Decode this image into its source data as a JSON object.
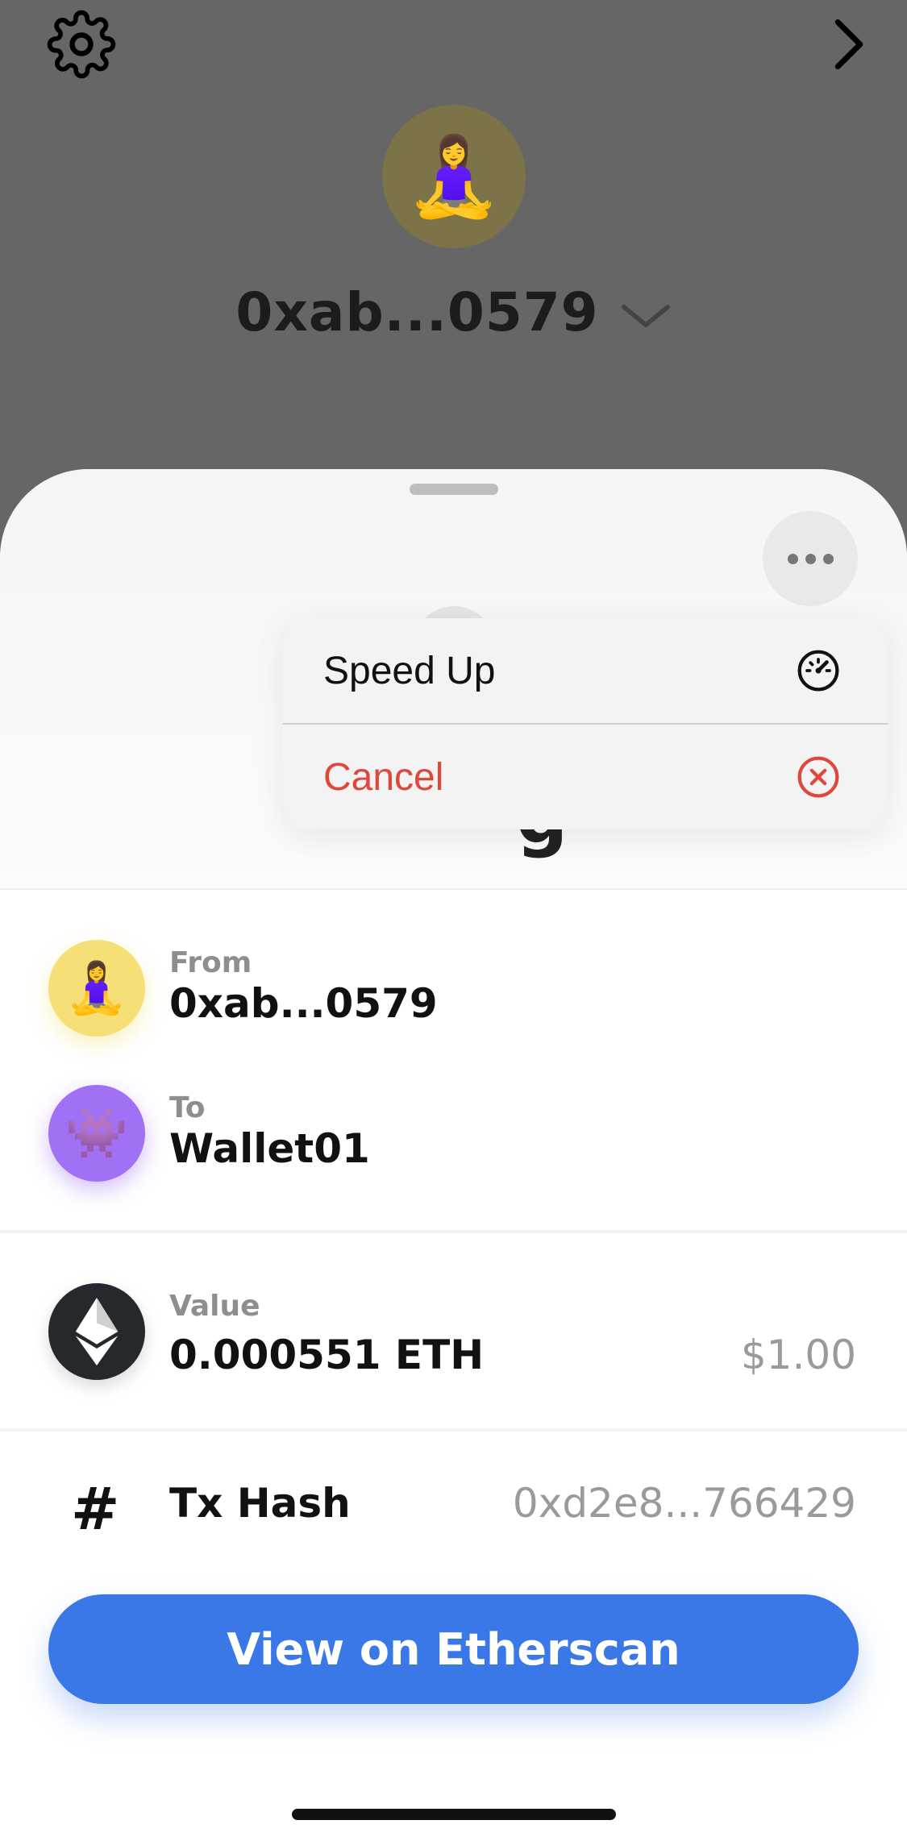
{
  "header": {
    "settings_icon": "gear-icon",
    "next_icon": "chevron-right-icon",
    "avatar_emoji": "🧘‍♀️",
    "wallet_address": "0xab...0579",
    "dropdown_icon": "chevron-down-icon"
  },
  "sheet": {
    "more_icon": "ellipsis-icon",
    "menu": {
      "speed_up_label": "Speed Up",
      "speed_up_icon": "speedometer-icon",
      "cancel_label": "Cancel",
      "cancel_icon": "x-circle-icon",
      "cancel_color": "#e0473b"
    },
    "from": {
      "label": "From",
      "address": "0xab...0579",
      "avatar_emoji": "🧘‍♀️",
      "avatar_color": "#f7df78"
    },
    "to": {
      "label": "To",
      "address": "Wallet01",
      "avatar_emoji": "👾",
      "avatar_color": "#a070f5"
    },
    "value": {
      "label": "Value",
      "amount": "0.000551 ETH",
      "fiat": "$1.00",
      "icon": "ethereum-icon"
    },
    "tx_hash": {
      "symbol": "#",
      "label": "Tx Hash",
      "value": "0xd2e8...766429"
    },
    "etherscan_button_label": "View on Etherscan",
    "accent_color": "#3a78e8"
  }
}
